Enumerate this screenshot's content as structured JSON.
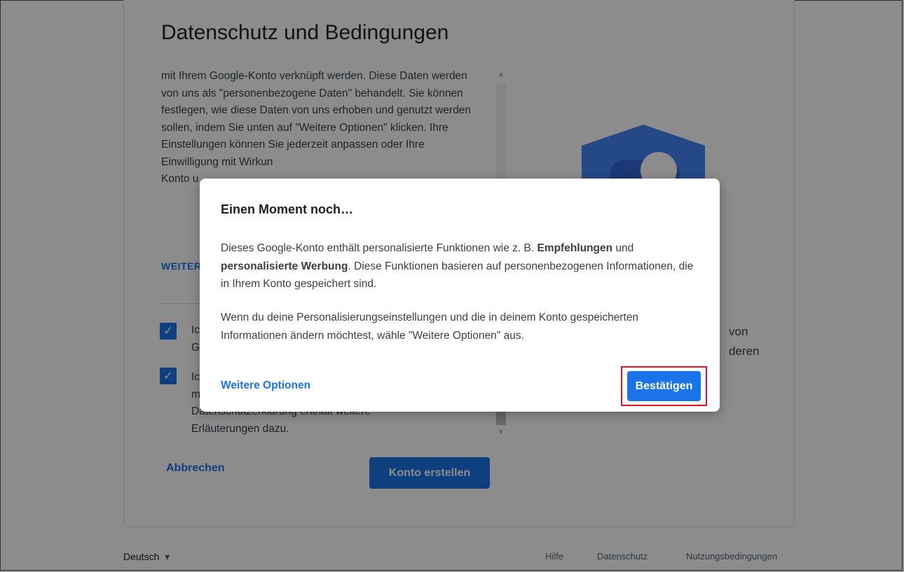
{
  "page": {
    "title": "Datenschutz und Bedingungen",
    "terms_text": "mit Ihrem Google-Konto verknüpft werden. Diese Daten werden von uns als \"personenbezogene Daten\" behandelt. Sie können festlegen, wie diese Daten von uns erhoben und genutzt werden sollen, indem Sie unten auf \"Weitere Optionen\" klicken. Ihre Einstellungen können Sie jederzeit anpassen oder Ihre Einwilligung mit Wirkun",
    "terms_text_tail": "Konto u",
    "more_options_label": "WEITER",
    "checkbox1_label": "Ic",
    "checkbox1_label2": "G",
    "checkbox2_label": "Ic",
    "checkbox2_label2": "m",
    "checkbox2_tail": "Datenschutzerklärung enthält weitere",
    "checkbox2_tail2": "Erläuterungen dazu.",
    "side_text_line1": "von",
    "side_text_line2": "deren",
    "cancel_label": "Abbrechen",
    "create_label": "Konto erstellen",
    "checkmark": "✓",
    "scroll_up": "˄",
    "scroll_down": "˅"
  },
  "footer": {
    "language": "Deutsch",
    "language_caret": "▾",
    "links": [
      "Hilfe",
      "Datenschutz",
      "Nutzungsbedingungen"
    ]
  },
  "dialog": {
    "title": "Einen Moment noch…",
    "p1_a": "Dieses Google-Konto enthält personalisierte Funktionen wie z. B. ",
    "p1_b": "Empfehlungen",
    "p1_c": " und ",
    "p1_d": "personalisierte Werbung",
    "p1_e": ". Diese Funktionen basieren auf personenbezogenen Informationen, die in Ihrem Konto gespeichert sind.",
    "p2": "Wenn du deine Personalisierungseinstellungen und die in deinem Konto gespeicherten Informationen ändern möchtest, wähle \"Weitere Optionen\" aus.",
    "more_options": "Weitere Optionen",
    "confirm": "Bestätigen"
  },
  "colors": {
    "accent": "#1a73e8",
    "highlight": "#e8101e",
    "shield": "#4285f4"
  }
}
